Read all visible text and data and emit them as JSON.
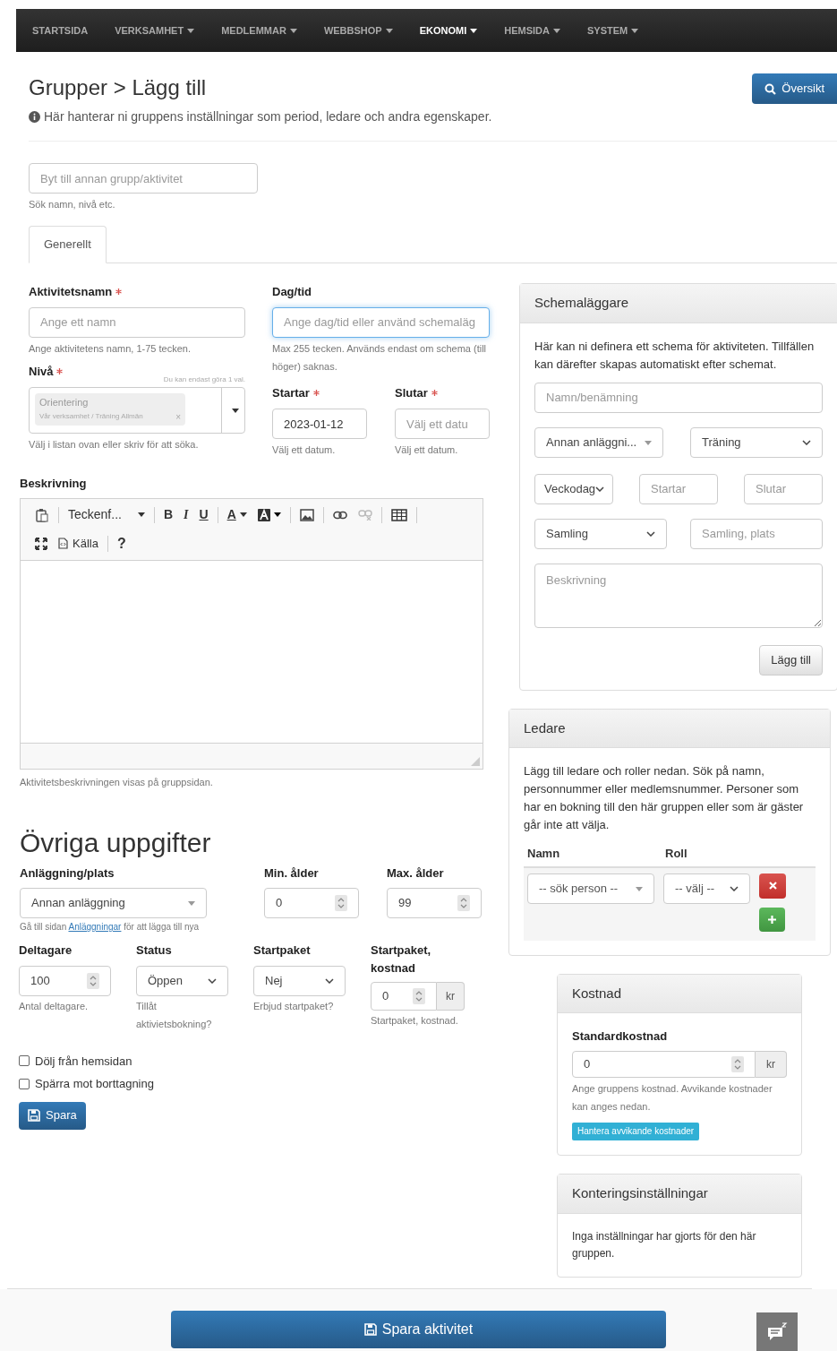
{
  "nav": [
    {
      "label": "STARTSIDA",
      "dropdown": false,
      "selected": false
    },
    {
      "label": "VERKSAMHET",
      "dropdown": true,
      "selected": false
    },
    {
      "label": "MEDLEMMAR",
      "dropdown": true,
      "selected": false
    },
    {
      "label": "WEBBSHOP",
      "dropdown": true,
      "selected": false
    },
    {
      "label": "EKONOMI",
      "dropdown": true,
      "selected": true
    },
    {
      "label": "HEMSIDA",
      "dropdown": true,
      "selected": false
    },
    {
      "label": "SYSTEM",
      "dropdown": true,
      "selected": false
    }
  ],
  "header": {
    "title": "Grupper > Lägg till",
    "subtitle": "Här hanterar ni gruppens inställningar som period, ledare och andra egenskaper.",
    "overview_button": "Översikt"
  },
  "switch_group": {
    "placeholder": "Byt till annan grupp/aktivitet",
    "help": "Sök namn, nivå etc."
  },
  "tabs": [
    {
      "label": "Generellt",
      "selected": true
    }
  ],
  "activity_name": {
    "label": "Aktivitetsnamn",
    "required": true,
    "placeholder": "Ange ett namn",
    "help": "Ange aktivitetens namn, 1-75 tecken."
  },
  "day_time": {
    "label": "Dag/tid",
    "required": false,
    "focused": true,
    "placeholder": "Ange dag/tid eller använd schemaläg",
    "help": "Max 255 tecken. Används endast om schema (till höger) saknas."
  },
  "level": {
    "label": "Nivå",
    "required": true,
    "note": "Du kan endast göra 1 val.",
    "tag_title": "Orientering",
    "tag_path": "Vår verksamhet / Träning Allmän",
    "tag_remove": "×",
    "help": "Välj i listan ovan eller skriv för att söka."
  },
  "starts": {
    "label": "Startar",
    "required": true,
    "value": "2023-01-12",
    "help": "Välj ett datum."
  },
  "ends": {
    "label": "Slutar",
    "required": true,
    "placeholder": "Välj ett datu",
    "help": "Välj ett datum."
  },
  "description": {
    "label": "Beskrivning",
    "font_label": "Teckenf...",
    "bold": "B",
    "italic": "I",
    "underline": "U",
    "text_color": "A",
    "source": "Källa",
    "help_button": "?",
    "help": "Aktivitetsbeskrivningen visas på gruppsidan."
  },
  "other": {
    "heading": "Övriga uppgifter",
    "facility": {
      "label": "Anläggning/plats",
      "value": "Annan anläggning",
      "help_before": "Gå till sidan",
      "help_link": "Anläggningar",
      "help_after": "för att lägga till nya"
    },
    "min_age": {
      "label": "Min. ålder",
      "value": "0"
    },
    "max_age": {
      "label": "Max. ålder",
      "value": "99"
    },
    "participants": {
      "label": "Deltagare",
      "value": "100",
      "help": "Antal deltagare."
    },
    "status": {
      "label": "Status",
      "value": "Öppen",
      "help": "Tillåt aktivietsbokning?"
    },
    "start_package": {
      "label": "Startpaket",
      "value": "Nej",
      "help": "Erbjud startpaket?"
    },
    "start_package_cost": {
      "label": "Startpaket, kostnad",
      "value": "0",
      "unit": "kr",
      "help": "Startpaket, kostnad."
    },
    "checkboxes": [
      {
        "label": "Dölj från hemsidan",
        "checked": false
      },
      {
        "label": "Spärra mot borttagning",
        "checked": false
      }
    ],
    "save_button": "Spara"
  },
  "scheduler": {
    "title": "Schemaläggare",
    "intro": "Här kan ni definera ett schema för aktiviteten. Tillfällen kan därefter skapas automatiskt efter schemat.",
    "name_placeholder": "Namn/benämning",
    "facility": "Annan anläggni...",
    "type": "Träning",
    "weekday": "Veckodag",
    "start_placeholder": "Startar",
    "end_placeholder": "Slutar",
    "gathering": "Samling",
    "gathering_place_placeholder": "Samling, plats",
    "description_placeholder": "Beskrivning",
    "add_button": "Lägg till"
  },
  "leaders": {
    "title": "Ledare",
    "intro": "Lägg till ledare och roller nedan. Sök på namn, personnummer eller medlemsnummer. Personer som har en bokning till den här gruppen eller som är gäster går inte att välja.",
    "columns": [
      "Namn",
      "Roll"
    ],
    "rows": [
      {
        "person_placeholder": "-- sök person --",
        "role": "-- välj --"
      }
    ]
  },
  "cost": {
    "title": "Kostnad",
    "label": "Standardkostnad",
    "value": "0",
    "unit": "kr",
    "help": "Ange gruppens kostnad. Avvikande kostnader kan anges nedan.",
    "button": "Hantera avvikande kostnader"
  },
  "accounting": {
    "title": "Konteringsinställningar",
    "text": "Inga inställningar har gjorts för den här gruppen."
  },
  "footer": {
    "save_button": "Spara aktivitet"
  }
}
